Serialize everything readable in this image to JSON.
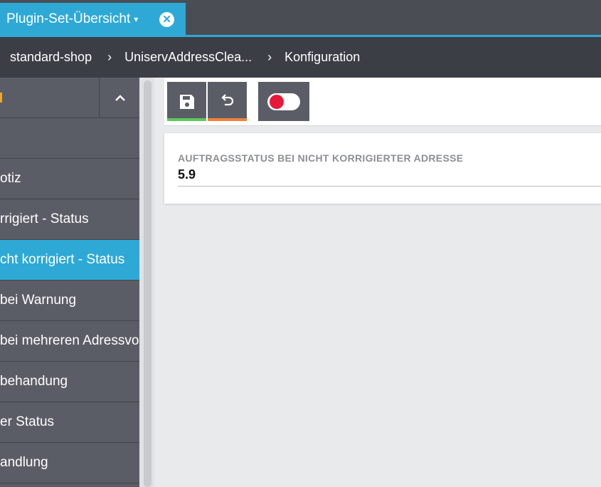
{
  "tab": {
    "title": "Plugin-Set-Übersicht",
    "caret": "▾",
    "close": "✕"
  },
  "breadcrumb": {
    "items": [
      "standard-shop",
      "UniservAddressClea...",
      "Konfiguration"
    ],
    "separator": "›"
  },
  "sidebar": {
    "header_chevron": "^",
    "items": [
      {
        "label": ""
      },
      {
        "label": "otiz"
      },
      {
        "label": "rrigiert - Status"
      },
      {
        "label": "cht korrigiert - Status",
        "active": true
      },
      {
        "label": "bei Warnung"
      },
      {
        "label": "bei mehreren Adressvo"
      },
      {
        "label": "behandung"
      },
      {
        "label": "er Status"
      },
      {
        "label": "andlung"
      }
    ]
  },
  "toolbar": {
    "save_icon": "floppy-disk-icon",
    "undo_icon": "undo-icon",
    "toggle_state": "off",
    "save_accent": "#5cc85c",
    "undo_accent": "#f0803c"
  },
  "field": {
    "label": "AUFTRAGSSTATUS BEI NICHT KORRIGIERTER ADRESSE",
    "value": "5.9"
  },
  "colors": {
    "accent": "#2ea9d6",
    "toggle_dot": "#e8183b"
  }
}
